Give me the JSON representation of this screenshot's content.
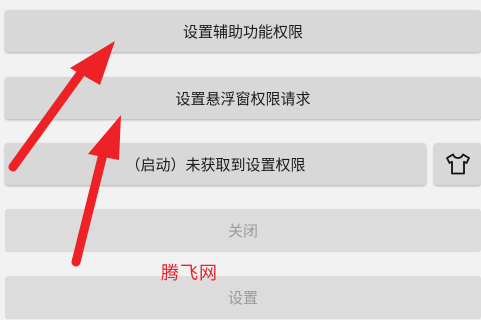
{
  "buttons": {
    "accessibility": "设置辅助功能权限",
    "overlay": "设置悬浮窗权限请求",
    "start": "（启动）未获取到设置权限",
    "close": "关闭",
    "settings": "设置"
  },
  "icons": {
    "skin": "tshirt-icon"
  },
  "watermark": "腾飞网",
  "colors": {
    "arrow": "#ee2127",
    "watermark": "#e8202a",
    "button": "#d8d8d8"
  }
}
